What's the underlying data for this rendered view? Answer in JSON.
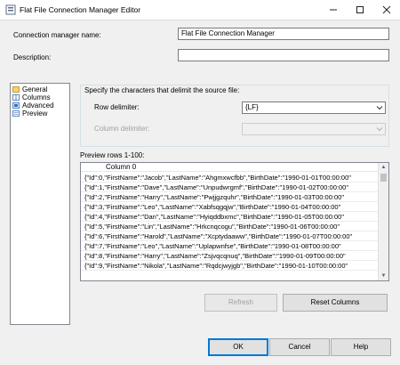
{
  "window": {
    "title": "Flat File Connection Manager Editor",
    "controls": [
      "minimize",
      "maximize",
      "close"
    ]
  },
  "form": {
    "connection_name_label": "Connection manager name:",
    "connection_name_value": "Flat File Connection Manager",
    "description_label": "Description:",
    "description_value": ""
  },
  "nav": {
    "items": [
      {
        "label": "General",
        "icon": "general-icon"
      },
      {
        "label": "Columns",
        "icon": "columns-icon"
      },
      {
        "label": "Advanced",
        "icon": "advanced-icon"
      },
      {
        "label": "Preview",
        "icon": "preview-icon"
      }
    ]
  },
  "delimit": {
    "heading": "Specify the characters that delimit the source file:",
    "row_delimiter_label": "Row delimiter:",
    "row_delimiter_value": "{LF}",
    "column_delimiter_label": "Column delimiter:",
    "column_delimiter_value": ""
  },
  "preview": {
    "label": "Preview rows 1-100:",
    "column_header": "Column 0",
    "rows": [
      "{\"Id\":0,\"FirstName\":\"Jacob\",\"LastName\":\"Ahgmxwcfbb\",\"BirthDate\":\"1990-01-01T00:00:00\"",
      "{\"Id\":1,\"FirstName\":\"Dave\",\"LastName\":\"Unpudwrgmf\",\"BirthDate\":\"1990-01-02T00:00:00\"",
      "{\"Id\":2,\"FirstName\":\"Harry\",\"LastName\":\"Pwjjgzquhr\",\"BirthDate\":\"1990-01-03T00:00:00\"",
      "{\"Id\":3,\"FirstName\":\"Leo\",\"LastName\":\"Xabfsqgqjw\",\"BirthDate\":\"1990-01-04T00:00:00\"",
      "{\"Id\":4,\"FirstName\":\"Dan\",\"LastName\":\"Hyiqddbxmc\",\"BirthDate\":\"1990-01-05T00:00:00\"",
      "{\"Id\":5,\"FirstName\":\"Lin\",\"LastName\":\"Hrkcnqcogu\",\"BirthDate\":\"1990-01-06T00:00:00\"",
      "{\"Id\":6,\"FirstName\":\"Harold\",\"LastName\":\"Xcptydaaww\",\"BirthDate\":\"1990-01-07T00:00:00\"",
      "{\"Id\":7,\"FirstName\":\"Leo\",\"LastName\":\"Uplapwnfse\",\"BirthDate\":\"1990-01-08T00:00:00\"",
      "{\"Id\":8,\"FirstName\":\"Harry\",\"LastName\":\"Zsjvqcqnuq\",\"BirthDate\":\"1990-01-09T00:00:00\"",
      "{\"Id\":9,\"FirstName\":\"Nikola\",\"LastName\":\"Rqdcjwyjgb\",\"BirthDate\":\"1990-01-10T00:00:00\""
    ]
  },
  "buttons": {
    "refresh": "Refresh",
    "reset_columns": "Reset Columns",
    "ok": "OK",
    "cancel": "Cancel",
    "help": "Help"
  },
  "colors": {
    "accent": "#0078d7",
    "window_bg": "#f0f0f0"
  }
}
